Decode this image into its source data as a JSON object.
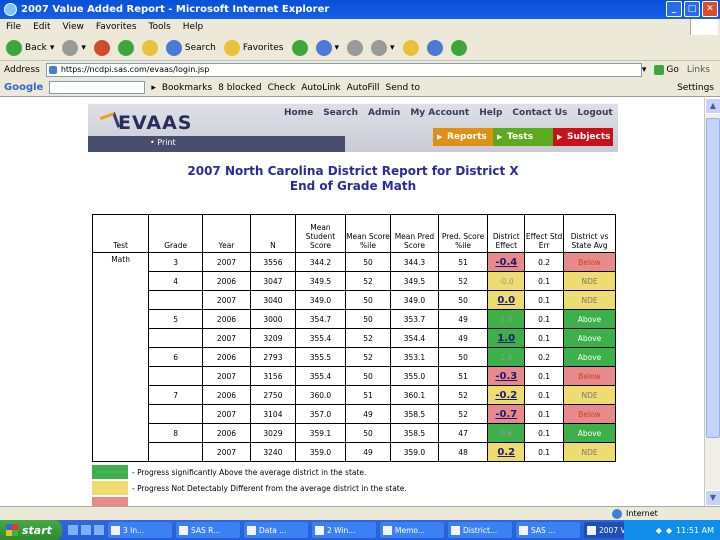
{
  "window": {
    "title": "2007 Value Added Report - Microsoft Internet Explorer"
  },
  "menu": [
    "File",
    "Edit",
    "View",
    "Favorites",
    "Tools",
    "Help"
  ],
  "toolbar": {
    "back": "Back",
    "search": "Search",
    "favorites": "Favorites"
  },
  "address": {
    "label": "Address",
    "url": "https://ncdpi.sas.com/evaas/login.jsp",
    "go": "Go",
    "links": "Links"
  },
  "googlebar": {
    "label": "Google",
    "bookmarks": "Bookmarks",
    "blocked": "8 blocked",
    "check": "Check",
    "autolink": "AutoLink",
    "autofill": "AutoFill",
    "sendto": "Send to",
    "settings": "Settings"
  },
  "site": {
    "logo": "EVAAS",
    "nav": [
      "Home",
      "Search",
      "Admin",
      "My Account",
      "Help",
      "Contact Us",
      "Logout"
    ],
    "tabs": [
      "Reports",
      "Tests",
      "Subjects"
    ],
    "print": "• Print"
  },
  "report": {
    "title_line1": "2007 North Carolina District Report for District X",
    "title_line2": "End of Grade Math",
    "headers": [
      "Test",
      "Grade",
      "Year",
      "N",
      "Mean Student Score",
      "Mean Score %ile",
      "Mean Pred Score",
      "Pred. Score %ile",
      "District Effect",
      "Effect Std Err",
      "District vs State Avg"
    ],
    "test": "Math",
    "rows": [
      {
        "grade": "3",
        "year": "2007",
        "n": "3556",
        "mss": "344.2",
        "msp": "50",
        "mps": "344.3",
        "psp": "51",
        "effect": "-0.4",
        "err": "0.2",
        "cmp": "Below"
      },
      {
        "grade": "4",
        "year": "2006",
        "n": "3047",
        "mss": "349.5",
        "msp": "52",
        "mps": "349.5",
        "psp": "52",
        "effect": "-0.0",
        "err": "0.1",
        "cmp": "NDE"
      },
      {
        "grade": "",
        "year": "2007",
        "n": "3040",
        "mss": "349.0",
        "msp": "50",
        "mps": "349.0",
        "psp": "50",
        "effect": "0.0",
        "err": "0.1",
        "cmp": "NDE"
      },
      {
        "grade": "5",
        "year": "2006",
        "n": "3000",
        "mss": "354.7",
        "msp": "50",
        "mps": "353.7",
        "psp": "49",
        "effect": "1.0",
        "err": "0.1",
        "cmp": "Above"
      },
      {
        "grade": "",
        "year": "2007",
        "n": "3209",
        "mss": "355.4",
        "msp": "52",
        "mps": "354.4",
        "psp": "49",
        "effect": "1.0",
        "err": "0.1",
        "cmp": "Above"
      },
      {
        "grade": "6",
        "year": "2006",
        "n": "2793",
        "mss": "355.5",
        "msp": "52",
        "mps": "353.1",
        "psp": "50",
        "effect": "2.4",
        "err": "0.2",
        "cmp": "Above"
      },
      {
        "grade": "",
        "year": "2007",
        "n": "3156",
        "mss": "355.4",
        "msp": "50",
        "mps": "355.0",
        "psp": "51",
        "effect": "-0.3",
        "err": "0.1",
        "cmp": "Below"
      },
      {
        "grade": "7",
        "year": "2006",
        "n": "2750",
        "mss": "360.0",
        "msp": "51",
        "mps": "360.1",
        "psp": "52",
        "effect": "-0.2",
        "err": "0.1",
        "cmp": "NDE"
      },
      {
        "grade": "",
        "year": "2007",
        "n": "3104",
        "mss": "357.0",
        "msp": "49",
        "mps": "358.5",
        "psp": "52",
        "effect": "-0.7",
        "err": "0.1",
        "cmp": "Below"
      },
      {
        "grade": "8",
        "year": "2006",
        "n": "3029",
        "mss": "359.1",
        "msp": "50",
        "mps": "358.5",
        "psp": "47",
        "effect": "0.6",
        "err": "0.1",
        "cmp": "Above"
      },
      {
        "grade": "",
        "year": "2007",
        "n": "3240",
        "mss": "359.0",
        "msp": "49",
        "mps": "359.0",
        "psp": "48",
        "effect": "0.2",
        "err": "0.1",
        "cmp": "NDE"
      }
    ],
    "legend": [
      {
        "color": "#3cb14a",
        "text": "- Progress significantly Above the average district in the state."
      },
      {
        "color": "#eedc70",
        "text": "- Progress Not Detectably Different from the average district in the state."
      },
      {
        "color": "#e98a8a",
        "text": ""
      }
    ]
  },
  "status": {
    "zone": "Internet"
  },
  "taskbar": {
    "start": "start",
    "tasks": [
      "3 In...",
      "SAS R...",
      "Data ...",
      "2 Win...",
      "Memo...",
      "District...",
      "SAS ...",
      "2007 V..."
    ],
    "clock": "11:51 AM"
  }
}
